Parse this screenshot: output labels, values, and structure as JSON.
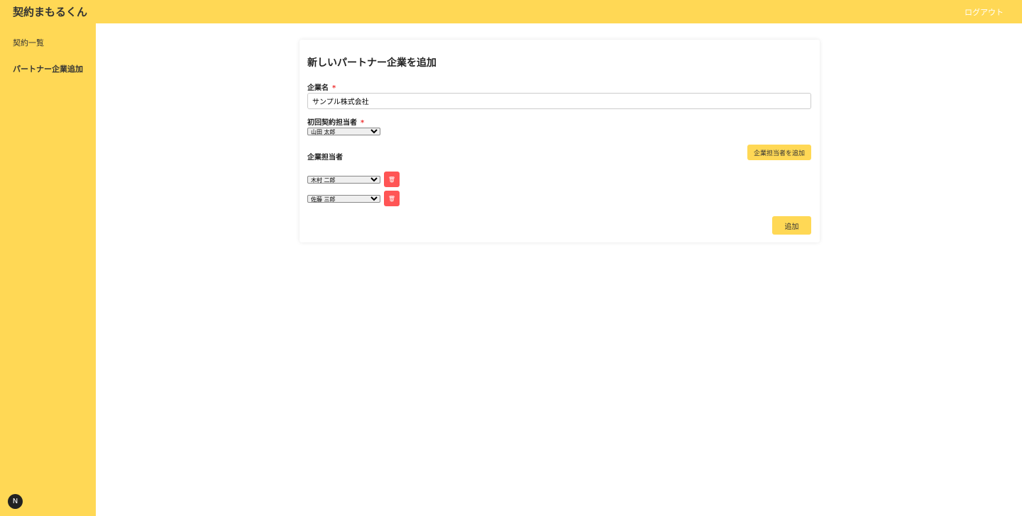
{
  "header": {
    "brand": "契約まもるくん",
    "logout": "ログアウト"
  },
  "sidebar": {
    "items": [
      {
        "label": "契約一覧"
      },
      {
        "label": "パートナー企業追加"
      }
    ]
  },
  "badge": "N",
  "form": {
    "title": "新しいパートナー企業を追加",
    "company_label": "企業名",
    "required": "*",
    "company_value": "サンプル株式会社",
    "first_contact_label": "初回契約担当者",
    "first_contact_value": "山田 太郎",
    "contacts_label": "企業担当者",
    "add_contact": "企業担当者を追加",
    "contacts": [
      "木村 二郎",
      "佐藤 三郎"
    ],
    "delete_icon": "🗑",
    "submit": "追加"
  }
}
